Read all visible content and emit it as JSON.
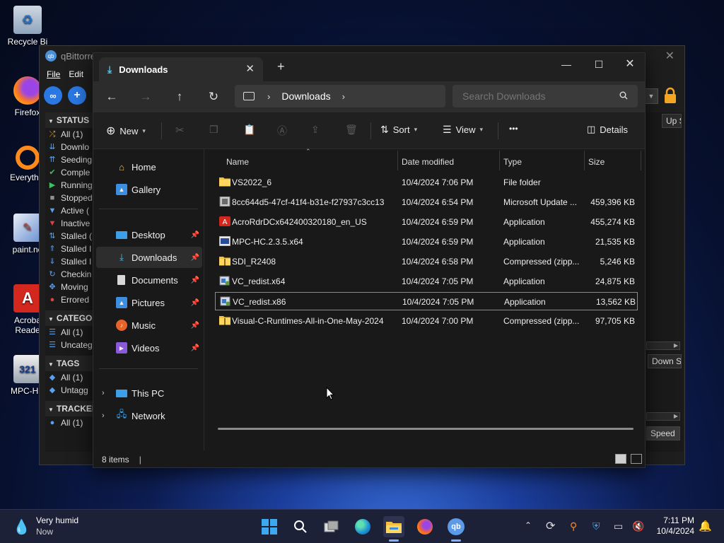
{
  "desktop": {
    "icons": [
      {
        "label": "Recycle Bi"
      },
      {
        "label": "Firefox"
      },
      {
        "label": "Everythin"
      },
      {
        "label": "paint.ne"
      },
      {
        "label": "Acroba Reade"
      },
      {
        "label": "MPC-HC"
      }
    ]
  },
  "qbittorrent": {
    "title": "qBittorre",
    "menu": [
      "File",
      "Edit"
    ],
    "status_header": "STATUS",
    "status_items": [
      {
        "label": "All (1)",
        "icon": "shuffle-icon",
        "color": "#e0a030"
      },
      {
        "label": "Downlo",
        "icon": "download-arrows-icon",
        "color": "#5aa0f0"
      },
      {
        "label": "Seeding",
        "icon": "upload-arrows-icon",
        "color": "#5aa0f0"
      },
      {
        "label": "Comple",
        "icon": "check-icon",
        "color": "#40c060"
      },
      {
        "label": "Running",
        "icon": "play-icon",
        "color": "#40c060"
      },
      {
        "label": "Stopped",
        "icon": "stop-icon",
        "color": "#909090"
      },
      {
        "label": "Active (",
        "icon": "filter-icon",
        "color": "#5aa0f0"
      },
      {
        "label": "Inactive",
        "icon": "filter-icon",
        "color": "#e04040"
      },
      {
        "label": "Stalled (",
        "icon": "up-down-icon",
        "color": "#5aa0f0"
      },
      {
        "label": "Stalled I",
        "icon": "upload-icon",
        "color": "#5aa0f0"
      },
      {
        "label": "Stalled I",
        "icon": "download-icon",
        "color": "#5aa0f0"
      },
      {
        "label": "Checkin",
        "icon": "refresh-icon",
        "color": "#5aa0f0"
      },
      {
        "label": "Moving",
        "icon": "move-icon",
        "color": "#5aa0f0"
      },
      {
        "label": "Errored",
        "icon": "error-icon",
        "color": "#e04040"
      }
    ],
    "categories_header": "CATEGO",
    "category_items": [
      {
        "label": "All (1)",
        "icon": "list-icon"
      },
      {
        "label": "Uncateg",
        "icon": "list-icon"
      }
    ],
    "tags_header": "TAGS",
    "tag_items": [
      {
        "label": "All (1)",
        "icon": "tag-icon"
      },
      {
        "label": "Untagg",
        "icon": "tag-icon"
      }
    ],
    "trackers_header": "TRACKER",
    "tracker_items": [
      {
        "label": "All (1)",
        "icon": "pin-icon"
      }
    ],
    "col_up": "Up S",
    "col_down": "Down S",
    "col_speed": "Speed"
  },
  "explorer": {
    "tab_title": "Downloads",
    "address": {
      "location": "Downloads"
    },
    "search": {
      "placeholder": "Search Downloads"
    },
    "commands": {
      "new": "New",
      "sort": "Sort",
      "view": "View",
      "more": "•••",
      "details": "Details"
    },
    "nav": {
      "home": "Home",
      "gallery": "Gallery",
      "desktop": "Desktop",
      "downloads": "Downloads",
      "documents": "Documents",
      "pictures": "Pictures",
      "music": "Music",
      "videos": "Videos",
      "this_pc": "This PC",
      "network": "Network"
    },
    "columns": {
      "name": "Name",
      "date": "Date modified",
      "type": "Type",
      "size": "Size"
    },
    "files": [
      {
        "name": "VS2022_6",
        "date": "10/4/2024 7:06 PM",
        "type": "File folder",
        "size": "",
        "icon": "folder-icon"
      },
      {
        "name": "8cc644d5-47cf-41f4-b31e-f27937c3cc13",
        "date": "10/4/2024 6:54 PM",
        "type": "Microsoft Update ...",
        "size": "459,396 KB",
        "icon": "update-package-icon"
      },
      {
        "name": "AcroRdrDCx642400320180_en_US",
        "date": "10/4/2024 6:59 PM",
        "type": "Application",
        "size": "455,274 KB",
        "icon": "acrobat-installer-icon"
      },
      {
        "name": "MPC-HC.2.3.5.x64",
        "date": "10/4/2024 6:59 PM",
        "type": "Application",
        "size": "21,535 KB",
        "icon": "mpc-installer-icon"
      },
      {
        "name": "SDI_R2408",
        "date": "10/4/2024 6:58 PM",
        "type": "Compressed (zipp...",
        "size": "5,246 KB",
        "icon": "zip-folder-icon"
      },
      {
        "name": "VC_redist.x64",
        "date": "10/4/2024 7:05 PM",
        "type": "Application",
        "size": "24,875 KB",
        "icon": "installer-icon"
      },
      {
        "name": "VC_redist.x86",
        "date": "10/4/2024 7:05 PM",
        "type": "Application",
        "size": "13,562 KB",
        "icon": "installer-icon"
      },
      {
        "name": "Visual-C-Runtimes-All-in-One-May-2024",
        "date": "10/4/2024 7:00 PM",
        "type": "Compressed (zipp...",
        "size": "97,705 KB",
        "icon": "zip-folder-icon"
      }
    ],
    "selected_index": 6,
    "status": {
      "count": "8 items",
      "separator": "|"
    }
  },
  "taskbar": {
    "weather": {
      "line1": "Very humid",
      "line2": "Now"
    },
    "clock": {
      "time": "7:11 PM",
      "date": "10/4/2024"
    }
  }
}
